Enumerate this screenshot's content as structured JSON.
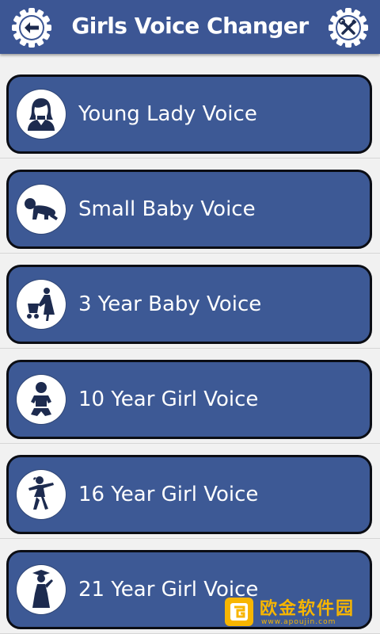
{
  "header": {
    "title": "Girls Voice Changer",
    "back_icon": "back-arrow-icon",
    "tools_icon": "tools-icon"
  },
  "voices": [
    {
      "label": "Young Lady Voice",
      "icon": "young-lady-icon"
    },
    {
      "label": "Small Baby Voice",
      "icon": "crawling-baby-icon"
    },
    {
      "label": "3 Year Baby Voice",
      "icon": "mother-stroller-icon"
    },
    {
      "label": "10 Year Girl Voice",
      "icon": "baby-icon"
    },
    {
      "label": "16 Year Girl Voice",
      "icon": "dancing-girl-icon"
    },
    {
      "label": "21 Year Girl Voice",
      "icon": "graduate-girl-icon"
    }
  ],
  "watermark": {
    "text": "欧金软件园",
    "url": "www.apoujin.com"
  },
  "colors": {
    "header": "#3c5694",
    "card": "#3d5995",
    "card_border": "#0b0d14",
    "background": "#f1f1f1",
    "watermark": "#f7b500"
  }
}
